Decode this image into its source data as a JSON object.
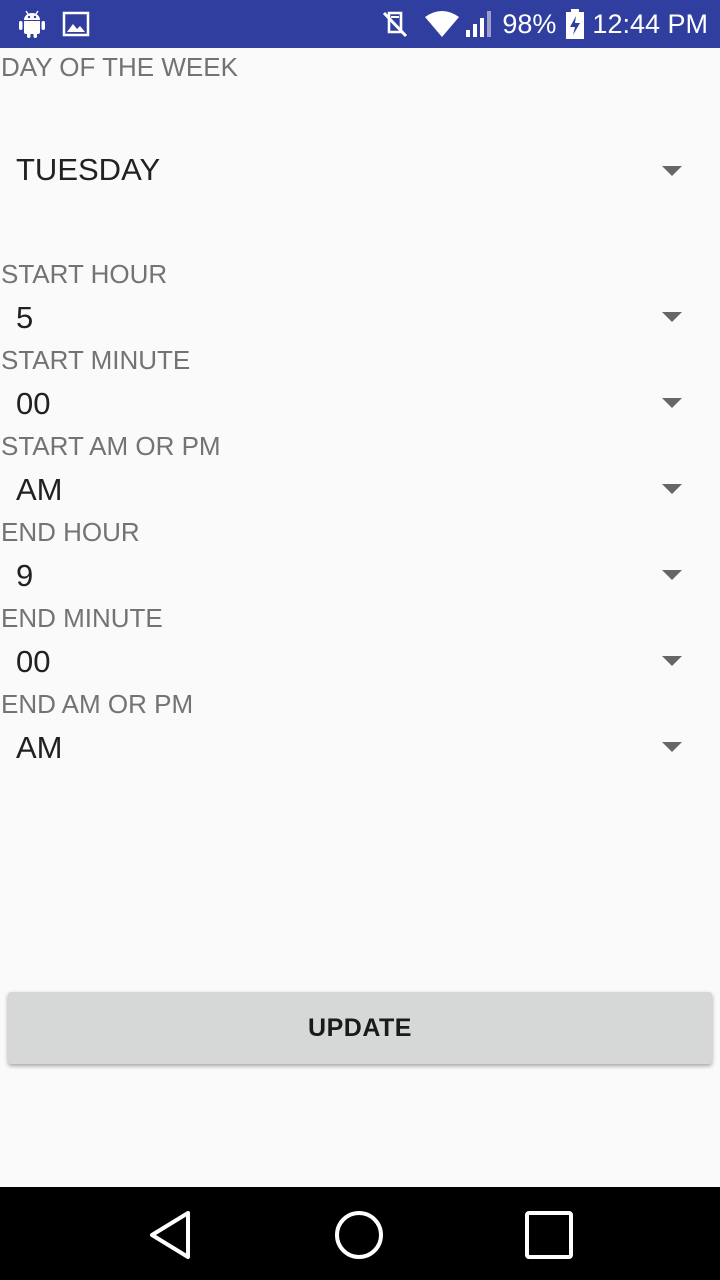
{
  "status_bar": {
    "battery": "98%",
    "time": "12:44 PM",
    "icons": [
      "android-icon",
      "image-icon",
      "mute-icon",
      "wifi-icon",
      "signal-icon",
      "battery-charging-icon"
    ],
    "background": "#303f9f"
  },
  "form": {
    "day_label": "DAY OF THE WEEK",
    "day_value": "TUESDAY",
    "start_hour_label": "START HOUR",
    "start_hour_value": "5",
    "start_minute_label": "START MINUTE",
    "start_minute_value": "00",
    "start_ampm_label": "START AM OR PM",
    "start_ampm_value": "AM",
    "end_hour_label": "END HOUR",
    "end_hour_value": "9",
    "end_minute_label": "END MINUTE",
    "end_minute_value": "00",
    "end_ampm_label": "END AM OR PM",
    "end_ampm_value": "AM"
  },
  "update_button": {
    "label": "UPDATE",
    "background": "#d6d7d7"
  },
  "nav_bar": {
    "icons": [
      "back-icon",
      "home-icon",
      "recents-icon"
    ]
  }
}
